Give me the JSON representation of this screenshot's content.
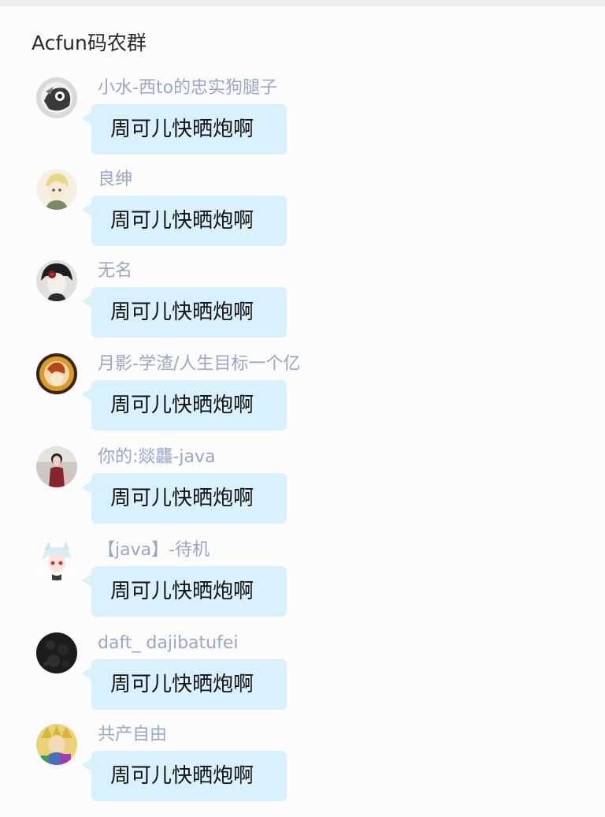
{
  "chat": {
    "title": "Acfun码农群"
  },
  "messages": [
    {
      "sender": "小水-西to的忠实狗腿子",
      "text": "周可儿快晒炮啊",
      "avatar": "masked-figure-avatar"
    },
    {
      "sender": "良绅",
      "text": "周可儿快晒炮啊",
      "avatar": "anime-boy-avatar"
    },
    {
      "sender": "无名",
      "text": "周可儿快晒炮啊",
      "avatar": "dark-hair-rose-avatar"
    },
    {
      "sender": "月影-学渣/人生目标一个亿",
      "text": "周可儿快晒炮啊",
      "avatar": "golden-ring-avatar"
    },
    {
      "sender": "你的:燚龘-java",
      "text": "周可儿快晒炮啊",
      "avatar": "girl-photo-avatar"
    },
    {
      "sender": "【java】-待机",
      "text": "周可儿快晒炮啊",
      "avatar": "white-hair-cat-ears-avatar"
    },
    {
      "sender": "daft_ dajibatufei",
      "text": "周可儿快晒炮啊",
      "avatar": "dark-texture-avatar"
    },
    {
      "sender": "共产自由",
      "text": "周可儿快晒炮啊",
      "avatar": "jojo-character-avatar"
    }
  ],
  "colors": {
    "bubble": "#d8f1fd",
    "sender_name": "#9aa7c4",
    "title_text": "#2a2a2a",
    "background": "#fcfcfc"
  }
}
